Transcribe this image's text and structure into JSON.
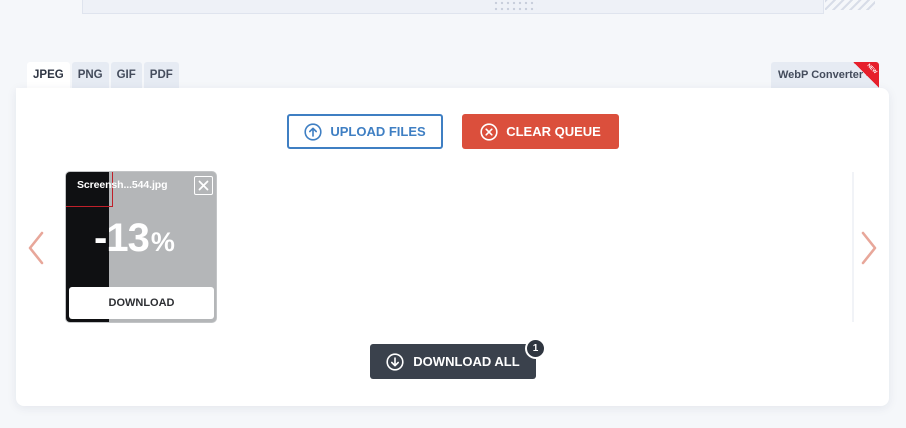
{
  "tabs": [
    {
      "label": "JPEG",
      "active": true
    },
    {
      "label": "PNG",
      "active": false
    },
    {
      "label": "GIF",
      "active": false
    },
    {
      "label": "PDF",
      "active": false
    }
  ],
  "side_tab": {
    "label": "WebP Converter",
    "ribbon": "NEW"
  },
  "toolbar": {
    "upload_label": "UPLOAD FILES",
    "upload_icon": "arrow-up-circle-icon",
    "clear_label": "CLEAR QUEUE",
    "clear_icon": "x-circle-icon"
  },
  "carousel": {
    "prev_icon": "chevron-left-icon",
    "next_icon": "chevron-right-icon"
  },
  "file": {
    "name": "Screensh...544.jpg",
    "reduction": "-13",
    "pct_sign": "%",
    "download_label": "DOWNLOAD"
  },
  "download_all": {
    "label": "DOWNLOAD ALL",
    "count": "1",
    "icon": "arrow-down-circle-icon"
  },
  "colors": {
    "upload_accent": "#3f7fc3",
    "clear_accent": "#db4f3c",
    "download_all_bg": "#3a414c",
    "arrow_color": "#e8a79a"
  }
}
